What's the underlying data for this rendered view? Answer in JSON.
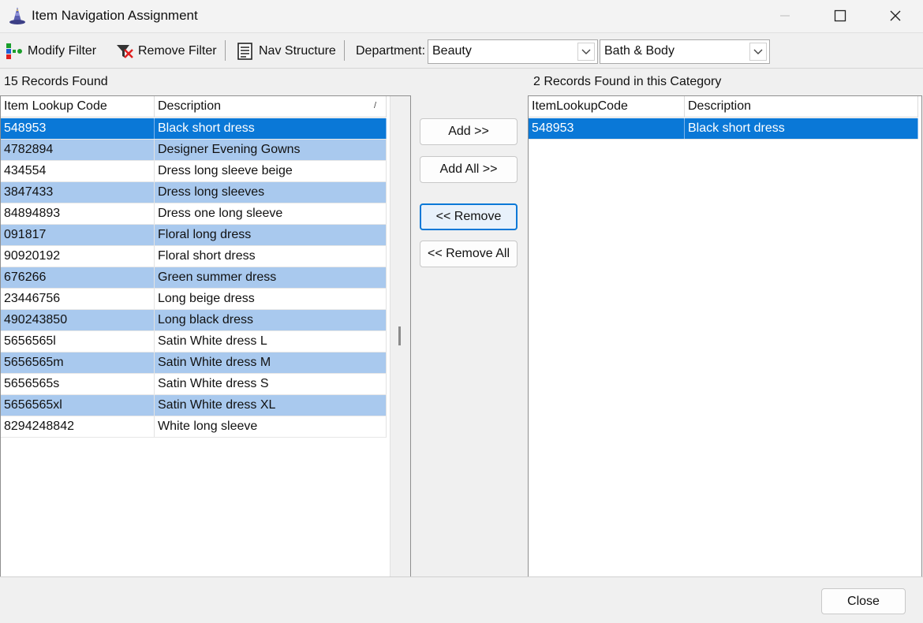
{
  "window": {
    "title": "Item Navigation Assignment",
    "icon": "wizard-hat-icon",
    "controls": [
      "minimize-icon",
      "maximize-icon",
      "close-icon"
    ]
  },
  "toolbar": {
    "modify_filter": "Modify Filter",
    "remove_filter": "Remove Filter",
    "nav_structure": "Nav Structure",
    "department_label": "Department:",
    "department_value": "Beauty",
    "category_value": "Bath & Body"
  },
  "left": {
    "count_label": "15 Records Found",
    "columns": [
      "Item Lookup Code",
      "Description"
    ],
    "rows": [
      {
        "code": "548953",
        "desc": "Black short dress"
      },
      {
        "code": "4782894",
        "desc": "Designer Evening Gowns"
      },
      {
        "code": "434554",
        "desc": "Dress long sleeve beige"
      },
      {
        "code": "3847433",
        "desc": "Dress long sleeves"
      },
      {
        "code": "84894893",
        "desc": "Dress one long sleeve"
      },
      {
        "code": "091817",
        "desc": "Floral long dress"
      },
      {
        "code": "90920192",
        "desc": "Floral short dress"
      },
      {
        "code": "676266",
        "desc": "Green summer dress"
      },
      {
        "code": "23446756",
        "desc": "Long beige dress"
      },
      {
        "code": "490243850",
        "desc": "Long black dress"
      },
      {
        "code": "5656565l",
        "desc": "Satin White dress L"
      },
      {
        "code": "5656565m",
        "desc": "Satin White dress M"
      },
      {
        "code": "5656565s",
        "desc": "Satin White dress S"
      },
      {
        "code": "5656565xl",
        "desc": "Satin White dress XL"
      },
      {
        "code": "8294248842",
        "desc": "White long sleeve"
      }
    ]
  },
  "actions": {
    "add": "Add >>",
    "add_all": "Add All >>",
    "remove": "<< Remove",
    "remove_all": "<< Remove All"
  },
  "right": {
    "count_label": "2 Records Found in this Category",
    "columns": [
      "ItemLookupCode",
      "Description"
    ],
    "rows": [
      {
        "code": "548953",
        "desc": "Black short dress"
      }
    ]
  },
  "footer": {
    "close": "Close"
  },
  "colors": {
    "selection": "#0a78d7",
    "alt_row": "#a9c9ee"
  }
}
